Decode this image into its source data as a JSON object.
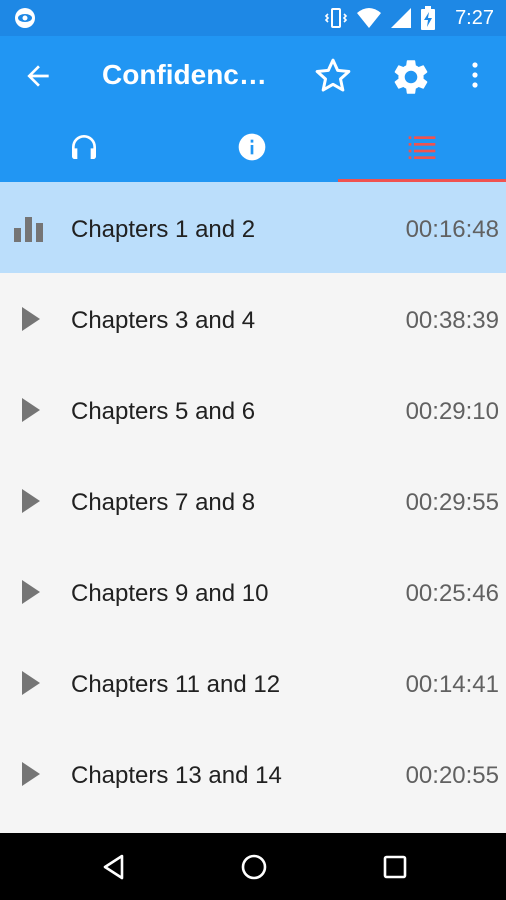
{
  "status_bar": {
    "time": "7:27",
    "icons": [
      "app-notification-icon",
      "vibrate-icon",
      "wifi-icon",
      "signal-icon",
      "battery-charging-icon"
    ]
  },
  "app_bar": {
    "title": "Confidence-…",
    "icons": [
      "back-arrow-icon",
      "star-outline-icon",
      "gear-icon",
      "more-vertical-icon"
    ]
  },
  "tabs": [
    {
      "icon": "headphones-icon",
      "selected": false
    },
    {
      "icon": "info-icon",
      "selected": false
    },
    {
      "icon": "list-icon",
      "selected": true
    }
  ],
  "chapters": [
    {
      "label": "Chapters 1 and 2",
      "duration": "00:16:48",
      "playing": true
    },
    {
      "label": "Chapters 3 and 4",
      "duration": "00:38:39",
      "playing": false
    },
    {
      "label": "Chapters 5 and 6",
      "duration": "00:29:10",
      "playing": false
    },
    {
      "label": "Chapters 7 and 8",
      "duration": "00:29:55",
      "playing": false
    },
    {
      "label": "Chapters 9 and 10",
      "duration": "00:25:46",
      "playing": false
    },
    {
      "label": "Chapters 11 and 12",
      "duration": "00:14:41",
      "playing": false
    },
    {
      "label": "Chapters 13 and 14",
      "duration": "00:20:55",
      "playing": false
    }
  ],
  "colors": {
    "primary": "#2196f3",
    "status_bar": "#1e88e5",
    "active_row": "#bbdefb",
    "tab_indicator": "#ef5350"
  },
  "nav_bar": {
    "icons": [
      "back-triangle-icon",
      "home-circle-icon",
      "recents-square-icon"
    ]
  }
}
